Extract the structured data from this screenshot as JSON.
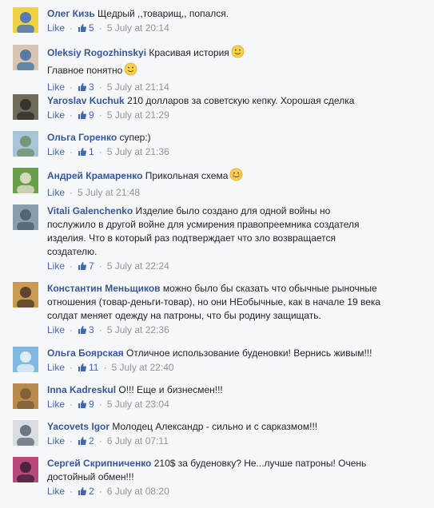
{
  "comments": [
    {
      "author": "Олег Кизь",
      "text_lines": [
        "Щедрый ,,товарищ,, попался."
      ],
      "emoji": "",
      "like_label": "Like",
      "like_count": "5",
      "time": "5 July at 20:14",
      "avatar_colors": [
        "#f0d245",
        "#3a6bc8"
      ]
    },
    {
      "author": "Oleksiy Rogozhinskyi",
      "text_lines": [
        "Красивая история",
        "Главное понятно"
      ],
      "emoji": "smile-emoji",
      "like_label": "Like",
      "like_count": "3",
      "time": "5 July at 21:14",
      "avatar_colors": [
        "#d7c4b1",
        "#3f6fa8"
      ]
    },
    {
      "author": "Yaroslav Kuchuk",
      "text_lines": [
        "210 долларов за советскую кепку. Хорошая сделка"
      ],
      "emoji": "",
      "like_label": "Like",
      "like_count": "9",
      "time": "5 July at 21:29",
      "avatar_colors": [
        "#6f6a5a",
        "#2e2c28"
      ]
    },
    {
      "author": "Ольга Горенко",
      "text_lines": [
        "супер:)"
      ],
      "emoji": "",
      "like_label": "Like",
      "like_count": "1",
      "time": "5 July at 21:36",
      "avatar_colors": [
        "#a8c5d8",
        "#6b8d6a"
      ]
    },
    {
      "author": "Андрей Крамаренко",
      "text_lines": [
        "Прикольная схема"
      ],
      "emoji": "blush-emoji",
      "like_label": "Like",
      "like_count": "",
      "time": "5 July at 21:48",
      "avatar_colors": [
        "#6a9f4a",
        "#e8e2d0"
      ]
    },
    {
      "author": "Vitali Galenchenko",
      "text_lines": [
        "Изделие было создано для одной войны но",
        "послужило в другой войне для усмирения правопреемника создателя",
        "изделия. Что в который раз подтверждает что зло возвращается",
        "создателю."
      ],
      "emoji": "",
      "like_label": "Like",
      "like_count": "7",
      "time": "5 July at 22:24",
      "avatar_colors": [
        "#8a9cb0",
        "#4b5a68"
      ]
    },
    {
      "author": "Константин Меньщиков",
      "text_lines": [
        "можно было бы сказать что обычные рыночные",
        "отношения (товар-деньги-товар), но они НЕобычные, как в начале 19 века",
        "солдат меняет одежду на патроны, что бы родину защищать."
      ],
      "emoji": "",
      "like_label": "Like",
      "like_count": "3",
      "time": "5 July at 22:36",
      "avatar_colors": [
        "#c89a52",
        "#4a3524"
      ]
    },
    {
      "author": "Ольга Боярская",
      "text_lines": [
        "Отличное использование буденовки! Вернись живым!!!"
      ],
      "emoji": "",
      "like_label": "Like",
      "like_count": "11",
      "time": "5 July at 22:40",
      "avatar_colors": [
        "#7fb8e0",
        "#eef4f8"
      ]
    },
    {
      "author": "Inna Kadreskul",
      "text_lines": [
        "О!!! Еще и бизнесмен!!!"
      ],
      "emoji": "",
      "like_label": "Like",
      "like_count": "9",
      "time": "5 July at 23:04",
      "avatar_colors": [
        "#b98b4e",
        "#7a5a34"
      ]
    },
    {
      "author": "Yacovets Igor",
      "text_lines": [
        "Молодец Александр - сильно и с сарказмом!!!"
      ],
      "emoji": "",
      "like_label": "Like",
      "like_count": "2",
      "time": "6 July at 07:11",
      "avatar_colors": [
        "#d9dde2",
        "#5a6470"
      ]
    },
    {
      "author": "Сергей Скрипниченко",
      "text_lines": [
        "210$ за буденовку? Не...лучше патроны! Очень",
        "достойный обмен!!!"
      ],
      "emoji": "",
      "like_label": "Like",
      "like_count": "2",
      "time": "6 July at 08:20",
      "avatar_colors": [
        "#b64b7a",
        "#3b1f38"
      ]
    }
  ]
}
